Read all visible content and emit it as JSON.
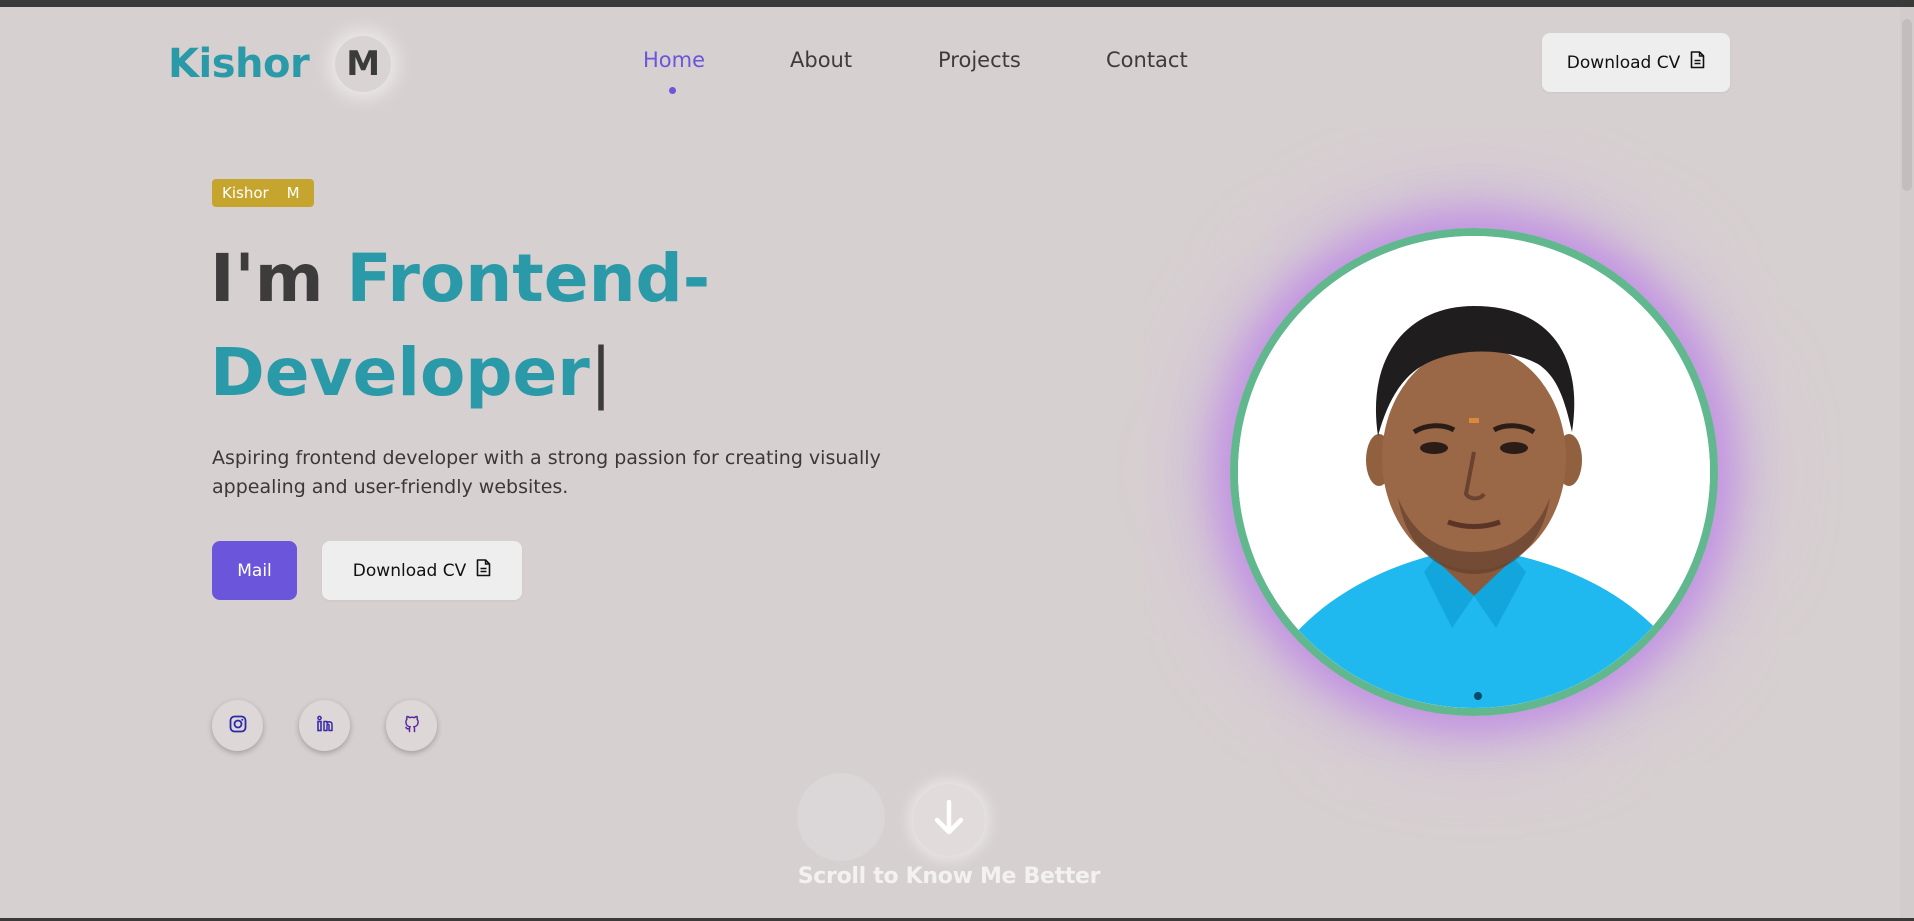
{
  "brand": {
    "first_name": "Kishor",
    "initial": "M"
  },
  "nav": {
    "links": [
      {
        "label": "Home",
        "active": true
      },
      {
        "label": "About",
        "active": false
      },
      {
        "label": "Projects",
        "active": false
      },
      {
        "label": "Contact",
        "active": false
      }
    ],
    "cv_label": "Download CV",
    "cv_icon": "document-icon"
  },
  "hero": {
    "badge": {
      "first": "Kishor",
      "initial": "M"
    },
    "headline_prefix": "I'm ",
    "headline_role": "Frontend-Developer",
    "cursor": "|",
    "description": "Aspiring frontend developer with a strong passion for creating visually appealing and user-friendly websites.",
    "mail_label": "Mail",
    "cv_label": "Download CV"
  },
  "social": [
    {
      "name": "instagram-icon"
    },
    {
      "name": "linkedin-icon"
    },
    {
      "name": "github-icon"
    }
  ],
  "scroll": {
    "label": "Scroll to Know Me Better",
    "icon": "arrow-down-icon"
  },
  "colors": {
    "background": "#d7d0d1",
    "accent_teal": "#2a9aa8",
    "accent_purple": "#6a55db",
    "badge_gold": "#c5a52d",
    "portrait_ring": "#62b88e"
  }
}
